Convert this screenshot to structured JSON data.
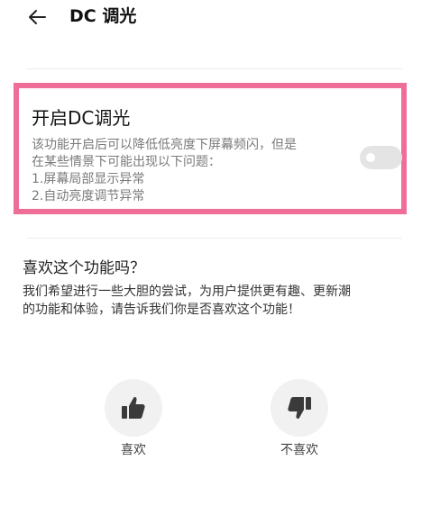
{
  "header": {
    "back_icon": "arrow-left-icon",
    "title": "DC 调光"
  },
  "dc_dimming": {
    "title": "开启DC调光",
    "description_lines": [
      "该功能开启后可以降低低亮度下屏幕频闪，但是",
      "在某些情景下可能出现以下问题：",
      "1.屏幕局部显示异常",
      "2.自动亮度调节异常"
    ],
    "toggle_state": "off",
    "highlight_color": "#ee6e98"
  },
  "feedback": {
    "heading": "喜欢这个功能吗？",
    "description_lines": [
      "我们希望进行一些大胆的尝试，为用户提供更有趣、更新潮",
      "的功能和体验，请告诉我们你是否喜欢这个功能！"
    ],
    "like": {
      "icon": "thumbs-up-icon",
      "label": "喜欢"
    },
    "dislike": {
      "icon": "thumbs-down-icon",
      "label": "不喜欢"
    }
  }
}
